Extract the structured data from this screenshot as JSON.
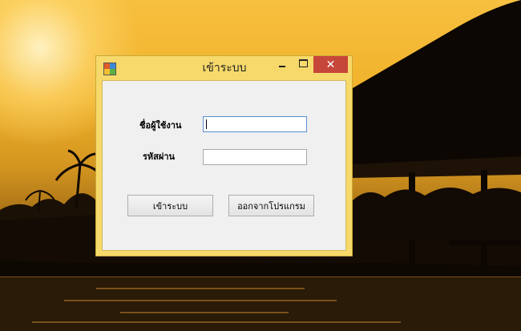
{
  "window": {
    "title": "เข้าระบบ",
    "close_glyph": "✕",
    "icons": [
      "app-icon",
      "minimize-icon",
      "maximize-icon",
      "close-icon"
    ]
  },
  "form": {
    "username_label": "ชื่อผู้ใช้งาน",
    "password_label": "รหัสผ่าน",
    "username_value": "",
    "password_value": ""
  },
  "buttons": {
    "login": "เข้าระบบ",
    "exit": "ออกจากโปรแกรม"
  },
  "colors": {
    "titlebar": "#f6d96a",
    "close_button": "#c7463a",
    "client_bg": "#f0f0f0",
    "focus_border": "#5a8fd0"
  }
}
